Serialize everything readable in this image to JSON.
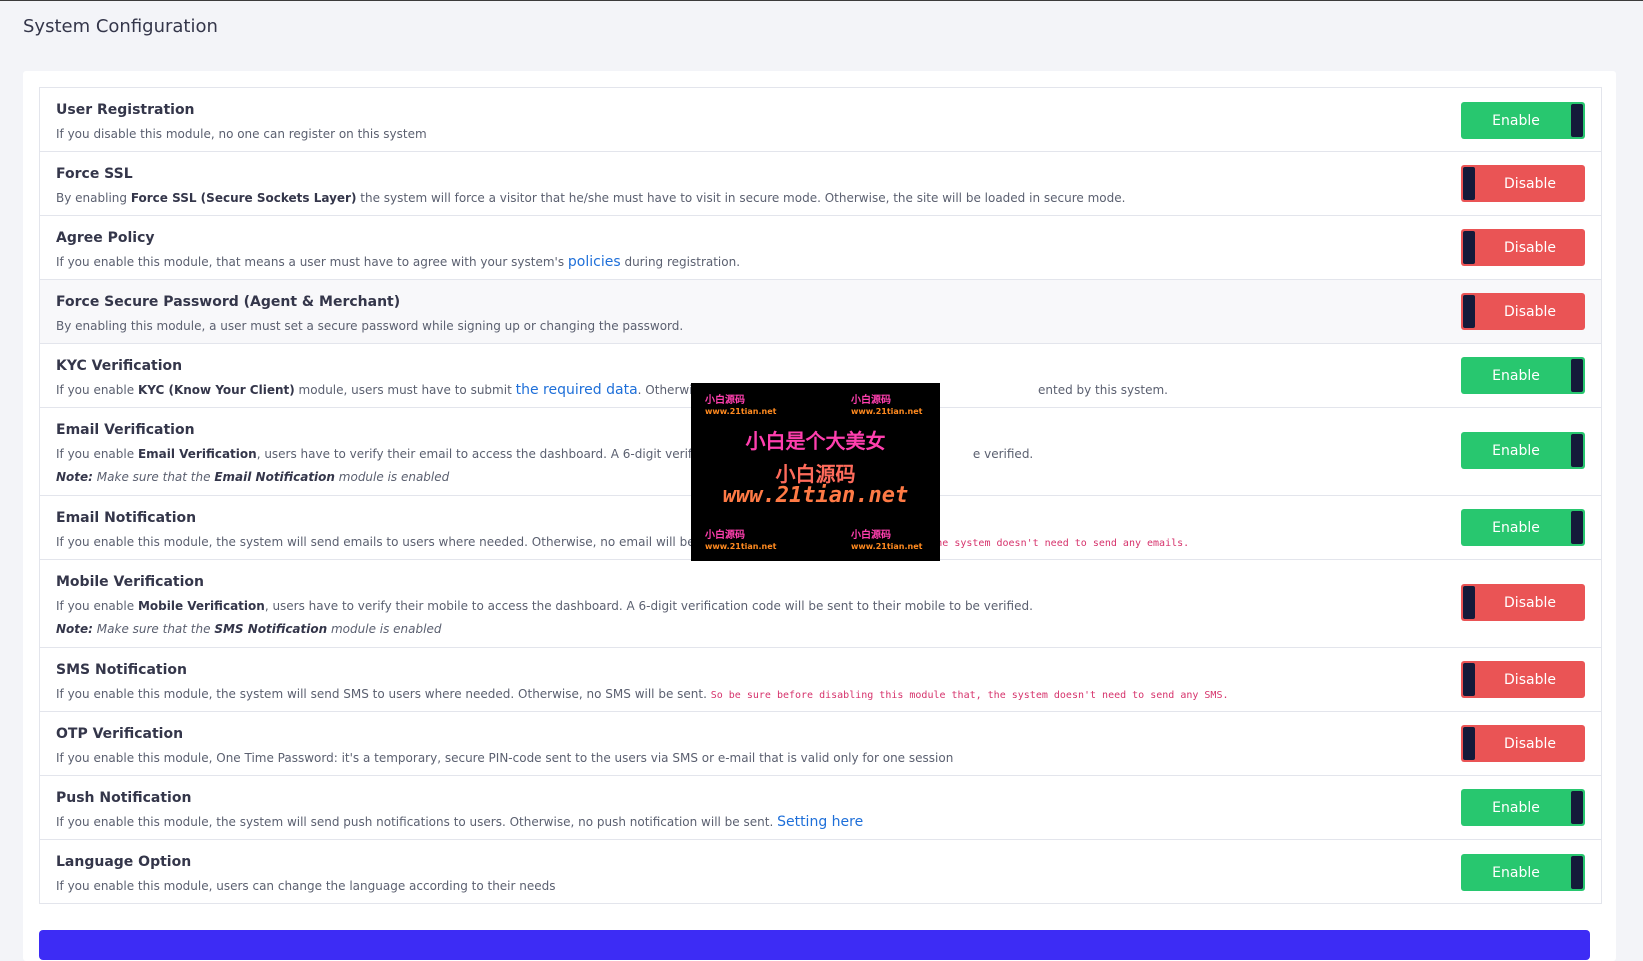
{
  "page": {
    "title": "System Configuration"
  },
  "modules": [
    {
      "title": "User Registration",
      "desc": [
        {
          "t": "If you disable this module, no one can register on this system"
        }
      ],
      "status": "Enable"
    },
    {
      "title": "Force SSL",
      "desc": [
        {
          "t": "By enabling "
        },
        {
          "t": "Force SSL (Secure Sockets Layer)",
          "s": "b"
        },
        {
          "t": " the system will force a visitor that he/she must have to visit in secure mode. Otherwise, the site will be loaded in secure mode."
        }
      ],
      "status": "Disable"
    },
    {
      "title": "Agree Policy",
      "desc": [
        {
          "t": "If you enable this module, that means a user must have to agree with your system's "
        },
        {
          "t": "policies",
          "s": "a"
        },
        {
          "t": " during registration."
        }
      ],
      "status": "Disable"
    },
    {
      "title": "Force Secure Password (Agent & Merchant)",
      "desc": [
        {
          "t": "By enabling this module, a user must set a secure password while signing up or changing the password."
        }
      ],
      "status": "Disable",
      "alt": true
    },
    {
      "title": "KYC Verification",
      "desc": [
        {
          "t": "If you enable "
        },
        {
          "t": "KYC (Know Your Client)",
          "s": "b"
        },
        {
          "t": " module, users must have to submit "
        },
        {
          "t": "the required data",
          "s": "a"
        },
        {
          "t": ". Otherwise"
        },
        {
          "t": "                                                                                       "
        },
        {
          "t": "ented by this system."
        }
      ],
      "status": "Enable"
    },
    {
      "title": "Email Verification",
      "desc": [
        {
          "t": "If you enable "
        },
        {
          "t": "Email Verification",
          "s": "b"
        },
        {
          "t": ", users have to verify their email to access the dashboard. A 6-digit verific"
        },
        {
          "t": "                                                                       "
        },
        {
          "t": "e verified."
        }
      ],
      "note": [
        {
          "t": "Note:",
          "s": "b"
        },
        {
          "t": " Make sure that the "
        },
        {
          "t": "Email Notification",
          "s": "b"
        },
        {
          "t": " module is enabled"
        }
      ],
      "status": "Enable"
    },
    {
      "title": "Email Notification",
      "desc": [
        {
          "t": "If you enable this module, the system will send emails to users where needed. Otherwise, no email will be "
        },
        {
          "t": "                                             "
        },
        {
          "t": "ule that, the system doesn't need to send any emails.",
          "s": "c"
        }
      ],
      "status": "Enable"
    },
    {
      "title": "Mobile Verification",
      "desc": [
        {
          "t": "If you enable "
        },
        {
          "t": "Mobile Verification",
          "s": "b"
        },
        {
          "t": ", users have to verify their mobile to access the dashboard. A 6-digit verification code will be sent to their mobile to be verified."
        }
      ],
      "note": [
        {
          "t": "Note:",
          "s": "b"
        },
        {
          "t": " Make sure that the "
        },
        {
          "t": "SMS Notification",
          "s": "b"
        },
        {
          "t": " module is enabled"
        }
      ],
      "status": "Disable"
    },
    {
      "title": "SMS Notification",
      "desc": [
        {
          "t": "If you enable this module, the system will send SMS to users where needed. Otherwise, no SMS will be sent. "
        },
        {
          "t": "So be sure before disabling this module that, the system doesn't need to send any SMS.",
          "s": "c"
        }
      ],
      "status": "Disable"
    },
    {
      "title": "OTP Verification",
      "desc": [
        {
          "t": "If you enable this module, One Time Password: it's a temporary, secure PIN-code sent to the users via SMS or e-mail that is valid only for one session"
        }
      ],
      "status": "Disable"
    },
    {
      "title": "Push Notification",
      "desc": [
        {
          "t": "If you enable this module, the system will send push notifications to users. Otherwise, no push notification will be sent. "
        },
        {
          "t": "Setting here",
          "s": "a"
        }
      ],
      "status": "Enable"
    },
    {
      "title": "Language Option",
      "desc": [
        {
          "t": "If you enable this module, users can change the language according to their needs"
        }
      ],
      "status": "Enable"
    }
  ],
  "watermark": {
    "main1": "小白是个大美女",
    "main2": "小白源码",
    "main3": "www.21tian.net",
    "corner_a": "小白源码",
    "corner_b": "www.21tian.net"
  },
  "colors": {
    "enable": "#28c76f",
    "disable": "#ea5455",
    "primary": "#3d2cf5"
  }
}
